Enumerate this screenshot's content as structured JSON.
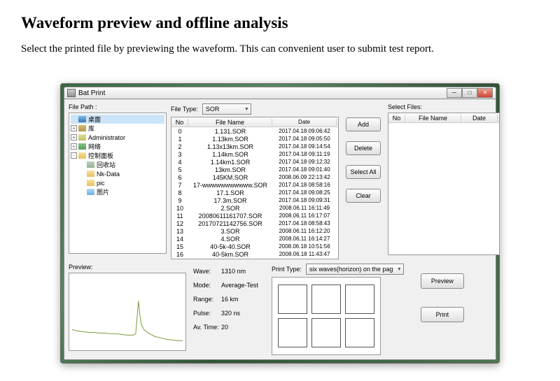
{
  "doc": {
    "title": "Waveform preview and offline analysis",
    "desc": "Select the printed file by previewing the waveform. This can convenient user to submit test report."
  },
  "window": {
    "title": "Bat Print"
  },
  "labels": {
    "filePath": "File Path :",
    "fileType": "File Type:",
    "selectFiles": "Select Files:",
    "preview": "Preview:",
    "printType": "Print Type:"
  },
  "fileType": {
    "selected": "SOR"
  },
  "printType": {
    "selected": "six waves(horizon) on the pag"
  },
  "tree": [
    {
      "depth": 0,
      "expand": "",
      "icon": "ico-desktop",
      "label": "桌面",
      "selected": true
    },
    {
      "depth": 0,
      "expand": "+",
      "icon": "ico-lib",
      "label": "库"
    },
    {
      "depth": 0,
      "expand": "+",
      "icon": "ico-user",
      "label": "Administrator"
    },
    {
      "depth": 0,
      "expand": "+",
      "icon": "ico-net",
      "label": "网络"
    },
    {
      "depth": 0,
      "expand": "-",
      "icon": "ico-folder",
      "label": "控制面板"
    },
    {
      "depth": 1,
      "expand": "",
      "icon": "ico-recycle",
      "label": "回收站"
    },
    {
      "depth": 1,
      "expand": "",
      "icon": "ico-folder",
      "label": "Nk-Data"
    },
    {
      "depth": 1,
      "expand": "",
      "icon": "ico-folder",
      "label": "pic"
    },
    {
      "depth": 1,
      "expand": "",
      "icon": "ico-pic",
      "label": "图片"
    }
  ],
  "files": [
    {
      "no": 0,
      "name": "1.131.SOR",
      "date": "2017.04.18 09:06:42"
    },
    {
      "no": 1,
      "name": "1.13km.SOR",
      "date": "2017.04.18 09:05:50"
    },
    {
      "no": 2,
      "name": "1.13x13km.SOR",
      "date": "2017.04.18 09:14:54"
    },
    {
      "no": 3,
      "name": "1.14km.SOR",
      "date": "2017.04.18 09:11:19"
    },
    {
      "no": 4,
      "name": "1.14km1.SOR",
      "date": "2017.04.18 09:12:32"
    },
    {
      "no": 5,
      "name": "13km.SOR",
      "date": "2017.04.18 09:01:40"
    },
    {
      "no": 6,
      "name": "145KM.SOR",
      "date": "2008.06.09 22:13:42"
    },
    {
      "no": 7,
      "name": "17-wwwwwwwwwww.SOR",
      "date": "2017.04.18 08:58:16"
    },
    {
      "no": 8,
      "name": "17.1.SOR",
      "date": "2017.04.18 09:08:25"
    },
    {
      "no": 9,
      "name": "17.3m.SOR",
      "date": "2017.04.18 09:09:31"
    },
    {
      "no": 10,
      "name": "2.SOR",
      "date": "2008.06.11 16:11:49"
    },
    {
      "no": 11,
      "name": "20080611161707.SOR",
      "date": "2008.06.11 16:17:07"
    },
    {
      "no": 12,
      "name": "20170721142756.SOR",
      "date": "2017.04.18 08:58:43"
    },
    {
      "no": 13,
      "name": "3.SOR",
      "date": "2008.06.11 16:12:20"
    },
    {
      "no": 14,
      "name": "4.SOR",
      "date": "2008.06.11 16:14:27"
    },
    {
      "no": 15,
      "name": "40-5k-40.SOR",
      "date": "2008.06.18 10:51:56"
    },
    {
      "no": 16,
      "name": "40-5km.SOR",
      "date": "2008.06.18 11:43:47"
    }
  ],
  "fileHeaders": {
    "no": "No",
    "fileName": "File Name",
    "date": "Date"
  },
  "selectHeaders": {
    "no": "No",
    "fileName": "File Name",
    "date": "Date"
  },
  "buttons": {
    "add": "Add",
    "delete": "Delete",
    "selectAll": "Select All",
    "clear": "Clear",
    "preview": "Preview",
    "print": "Print"
  },
  "info": {
    "wave": {
      "k": "Wave:",
      "v": "1310 nm"
    },
    "mode": {
      "k": "Mode:",
      "v": "Average-Test"
    },
    "range": {
      "k": "Range:",
      "v": "16 km"
    },
    "pulse": {
      "k": "Pulse:",
      "v": "320 ns"
    },
    "avtime": {
      "k": "Av. Time:",
      "v": "20"
    }
  }
}
